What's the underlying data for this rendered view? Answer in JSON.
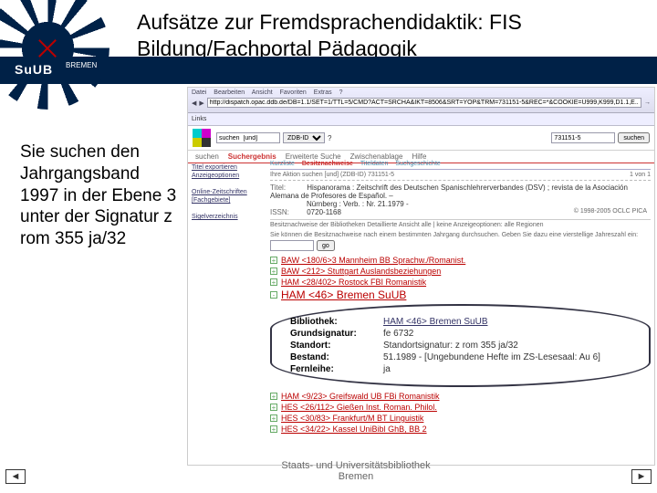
{
  "header": {
    "title_line1": "Aufsätze zur Fremdsprachendidaktik: FIS",
    "title_line2": "Bildung/Fachportal Pädagogik",
    "logo_text": "SuUB",
    "logo_sub": "BREMEN"
  },
  "sidebar": {
    "text": "Sie suchen den Jahrgangsband 1997 in der Ebene 3 unter der Signatur z rom 355 ja/32"
  },
  "browser": {
    "menu": [
      "Datei",
      "Bearbeiten",
      "Ansicht",
      "Favoriten",
      "Extras",
      "?"
    ],
    "url": "http://dispatch.opac.ddb.de/DB=1.1/SET=1/TTL=5/CMD?ACT=SRCHA&IKT=8506&SRT=YOP&TRM=731151-5&REC=*&COOKIE=U999,K999,D1.1,E...",
    "links_label": "Links",
    "copyright": "© 1998-2005 OCLC PICA"
  },
  "catalog": {
    "search_value": "731151-5",
    "search_field": "ZDB-ID",
    "search_hint": "suchen  [und]",
    "search_button": "suchen",
    "top_tabs": [
      "suchen",
      "Suchergebnis",
      "Erweiterte Suche",
      "Zwischenablage",
      "Hilfe"
    ],
    "top_tab_selected_index": 1,
    "left_links": [
      "Titel exportieren",
      "Anzeigeoptionen",
      "Online-Zeitschriften",
      "[Fachgebiete]",
      "Sigelverzeichnis"
    ],
    "sub_tabs": [
      "Kurzliste",
      "Besitznachweise",
      "Titeldaten",
      "Suchgeschichte"
    ],
    "sub_tab_selected_index": 1,
    "action_text": "Ihre Aktion  suchen [und] (ZDB-ID) 731151-5",
    "result_count": "1 von 1",
    "record": {
      "title_label": "Titel:",
      "title_value": "Hispanorama : Zeitschrift des Deutschen Spanischlehrerverbandes (DSV) ; revista de la Asociación Alemana de Profesores de Español. –",
      "title_place": "Nürnberg : Verb. : Nr. 21.1979 -",
      "issn_label": "ISSN:",
      "issn_value": "0720-1168"
    },
    "holdings_bar": "Besitznachweise der Bibliotheken  Detaillierte Ansicht  alle | keine   Anzeigeoptionen:  alle Regionen",
    "holdings_note": "Sie können die Besitznachweise nach einem bestimmten Jahrgang durchsuchen. Geben Sie dazu eine vierstellige Jahreszahl ein:",
    "year_button": "go",
    "libraries_top": [
      "BAW <180/6>3 Mannheim BB Sprachw./Romanist.",
      "BAW <212> Stuttgart Auslandsbeziehungen",
      "HAM <28/402> Rostock FBI Romanistik"
    ],
    "library_selected": "HAM <46> Bremen SuUB",
    "detail": {
      "bibliothek_label": "Bibliothek:",
      "bibliothek_value": "HAM <46> Bremen SuUB",
      "grundsig_label": "Grundsignatur:",
      "grundsig_value": "fe 6732",
      "standort_label": "Standort:",
      "standort_value": "Standortsignatur: z rom 355 ja/32",
      "bestand_label": "Bestand:",
      "bestand_value": "51.1989 - [Ungebundene Hefte im ZS-Lesesaal: Au 6]",
      "fernleihe_label": "Fernleihe:",
      "fernleihe_value": "ja"
    },
    "libraries_bottom": [
      "HAM <9/23> Greifswald UB FBi Romanistik",
      "HES <26/112> Gießen Inst. Roman. Philol.",
      "HES <30/83> Frankfurt/M BT Linguistik",
      "HES <34/22> Kassel UniBibl GhB, BB 2"
    ]
  },
  "footer": {
    "text_line1": "Staats- und Universitätsbibliothek",
    "text_line2": "Bremen",
    "prev": "◄",
    "next": "►"
  }
}
